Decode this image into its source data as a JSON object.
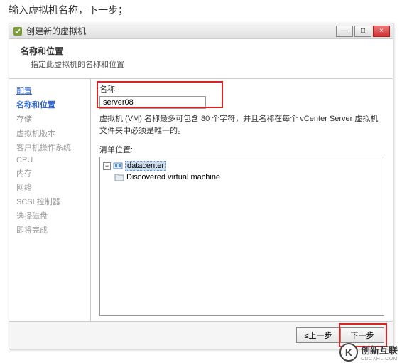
{
  "instruction": "输入虚拟机名称，下一步；",
  "window": {
    "title": "创建新的虚拟机",
    "controls": {
      "min": "—",
      "max": "□",
      "close": "×"
    }
  },
  "header": {
    "title": "名称和位置",
    "subtitle": "指定此虚拟机的名称和位置"
  },
  "sidebar": {
    "items": [
      {
        "label": "配置",
        "kind": "header"
      },
      {
        "label": "名称和位置",
        "kind": "active"
      },
      {
        "label": "存储",
        "kind": "disabled"
      },
      {
        "label": "虚拟机版本",
        "kind": "disabled"
      },
      {
        "label": "客户机操作系统",
        "kind": "disabled"
      },
      {
        "label": "CPU",
        "kind": "disabled"
      },
      {
        "label": "内存",
        "kind": "disabled"
      },
      {
        "label": "网络",
        "kind": "disabled"
      },
      {
        "label": "SCSI 控制器",
        "kind": "disabled"
      },
      {
        "label": "选择磁盘",
        "kind": "disabled"
      },
      {
        "label": "即将完成",
        "kind": "disabled"
      }
    ]
  },
  "main": {
    "name_label": "名称:",
    "name_value": "server08",
    "hint": "虚拟机 (VM) 名称最多可包含 80 个字符，并且名称在每个 vCenter Server 虚拟机文件夹中必须是唯一的。",
    "inventory_label": "清单位置:",
    "tree": {
      "root": {
        "label": "datacenter",
        "expanded": true
      },
      "child": {
        "label": "Discovered virtual machine"
      }
    }
  },
  "footer": {
    "back": "≤上一步",
    "next": "下一步"
  },
  "watermark": {
    "brand": "创新互联",
    "sub": "CDCXHL.COM"
  }
}
